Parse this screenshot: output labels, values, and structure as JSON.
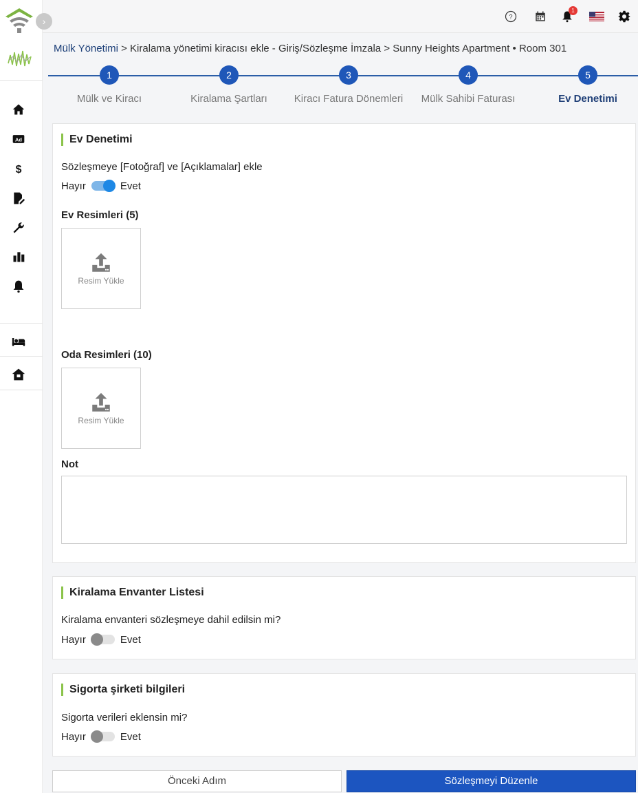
{
  "topbar": {
    "icons": [
      "help-icon",
      "calendar-icon",
      "bell-icon",
      "us-flag-icon",
      "gear-icon"
    ],
    "notification_count": "1"
  },
  "sidebar": {
    "items": [
      "home-icon",
      "ad-icon",
      "dollar-icon",
      "contract-icon",
      "wrench-icon",
      "bar-chart-icon",
      "bell-icon",
      "bed-icon",
      "house-icon"
    ]
  },
  "breadcrumb": {
    "root": "Mülk Yönetimi",
    "sep1": " > ",
    "middle": "Kiralama yönetimi kiracısı ekle - Giriş/Sözleşme İmzala",
    "sep2": " > ",
    "current": "Sunny Heights Apartment • Room 301"
  },
  "stepper": {
    "steps": [
      {
        "number": "1",
        "label": "Mülk ve Kiracı"
      },
      {
        "number": "2",
        "label": "Kiralama Şartları"
      },
      {
        "number": "3",
        "label": "Kiracı Fatura Dönemleri"
      },
      {
        "number": "4",
        "label": "Mülk Sahibi Faturası"
      },
      {
        "number": "5",
        "label": "Ev Denetimi"
      }
    ],
    "active_step": 5
  },
  "inspection": {
    "title": "Ev Denetimi",
    "question": "Sözleşmeye [Fotoğraf] ve [Açıklamalar] ekle",
    "no_label": "Hayır",
    "yes_label": "Evet",
    "toggle_on": true,
    "house_images_label": "Ev Resimleri (5)",
    "upload_label": "Resim Yükle",
    "room_images_label": "Oda Resimleri (10)",
    "note_label": "Not",
    "note_value": ""
  },
  "inventory": {
    "title": "Kiralama Envanter Listesi",
    "question": "Kiralama envanteri sözleşmeye dahil edilsin mi?",
    "no_label": "Hayır",
    "yes_label": "Evet",
    "toggle_on": false
  },
  "insurance": {
    "title": "Sigorta şirketi bilgileri",
    "question": "Sigorta verileri eklensin mi?",
    "no_label": "Hayır",
    "yes_label": "Evet",
    "toggle_on": false
  },
  "footer": {
    "prev_label": "Önceki Adım",
    "next_label": "Sözleşmeyi Düzenle"
  },
  "colors": {
    "primary": "#1c55c0",
    "accent_bar": "#8bc34a",
    "toggle_on": "#1e88e5"
  }
}
